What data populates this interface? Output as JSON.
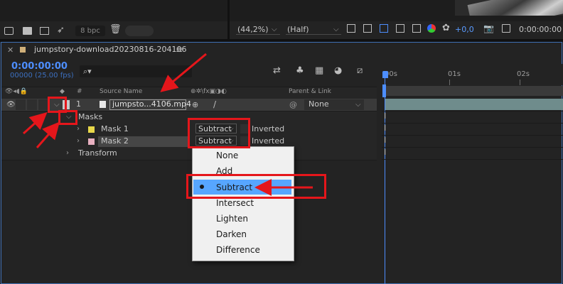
{
  "project_toolbar": {
    "bpc_label": "8 bpc"
  },
  "viewer_toolbar": {
    "zoom": "(44,2%)",
    "resolution": "(Half)",
    "exposure": "+0,0",
    "timecode": "0:00:00:00"
  },
  "composition": {
    "tab_name": "jumpstory-download20230816-204106",
    "menu_icon": "≡",
    "timecode": "0:00:00:00",
    "frames": "00000 (25.00 fps)"
  },
  "header": {
    "hash": "#",
    "source_name": "Source Name",
    "parent_link": "Parent & Link"
  },
  "ruler": {
    "ticks": [
      "00s",
      "01s",
      "02s"
    ]
  },
  "layer": {
    "number": "1",
    "name": "jumpsto...4106.mp4",
    "parent": "None"
  },
  "masks": {
    "group_label": "Masks",
    "items": [
      {
        "name": "Mask 1",
        "mode": "Subtract",
        "inverted": "Inverted",
        "color": "#e8d84a"
      },
      {
        "name": "Mask 2",
        "mode": "Subtract",
        "inverted": "Inverted",
        "color": "#e8b0c0"
      }
    ]
  },
  "transform": {
    "label": "Transform"
  },
  "mode_menu": {
    "options": [
      "None",
      "Add",
      "Subtract",
      "Intersect",
      "Lighten",
      "Darken",
      "Difference"
    ],
    "selected": "Subtract"
  },
  "colors": {
    "accent": "#4d8eff",
    "annotation": "#e5161b",
    "menu_highlight": "#57a6ff"
  }
}
